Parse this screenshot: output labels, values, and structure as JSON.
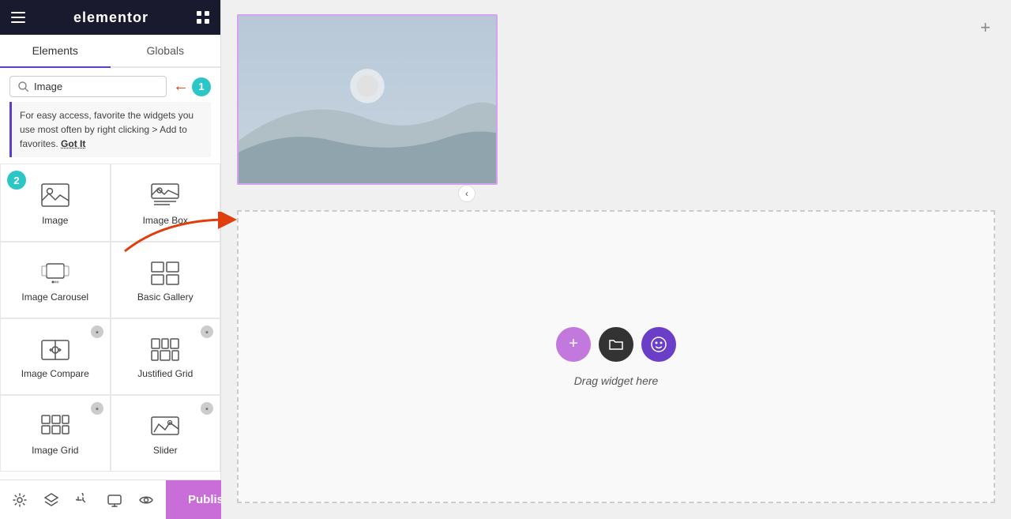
{
  "header": {
    "logo": "elementor",
    "hamburger_icon": "menu-icon",
    "grid_icon": "grid-icon"
  },
  "tabs": {
    "elements_label": "Elements",
    "globals_label": "Globals",
    "active": "elements"
  },
  "search": {
    "placeholder": "Image",
    "value": "Image"
  },
  "info_banner": {
    "text": "For easy access, favorite the widgets you use most often by right clicking > Add to favorites.",
    "cta": "Got It"
  },
  "badges": {
    "badge1_num": "1",
    "badge2_num": "2"
  },
  "widgets": [
    {
      "id": "image",
      "label": "Image",
      "icon": "image-icon",
      "pro": false
    },
    {
      "id": "image-box",
      "label": "Image Box",
      "icon": "image-box-icon",
      "pro": false
    },
    {
      "id": "image-carousel",
      "label": "Image Carousel",
      "icon": "image-carousel-icon",
      "pro": false
    },
    {
      "id": "basic-gallery",
      "label": "Basic Gallery",
      "icon": "basic-gallery-icon",
      "pro": false
    },
    {
      "id": "image-compare",
      "label": "Image Compare",
      "icon": "image-compare-icon",
      "pro": true
    },
    {
      "id": "justified-grid",
      "label": "Justified Grid",
      "icon": "justified-grid-icon",
      "pro": true
    },
    {
      "id": "image-grid",
      "label": "Image Grid",
      "icon": "image-grid-icon",
      "pro": true
    },
    {
      "id": "slider",
      "label": "Slider",
      "icon": "slider-icon",
      "pro": true
    }
  ],
  "canvas": {
    "drop_text": "Drag widget here"
  },
  "toolbar": {
    "settings_icon": "settings-icon",
    "layers_icon": "layers-icon",
    "history_icon": "history-icon",
    "responsive_icon": "responsive-icon",
    "eye_icon": "eye-icon",
    "publish_label": "Publish",
    "chevron_up_label": "▲"
  }
}
